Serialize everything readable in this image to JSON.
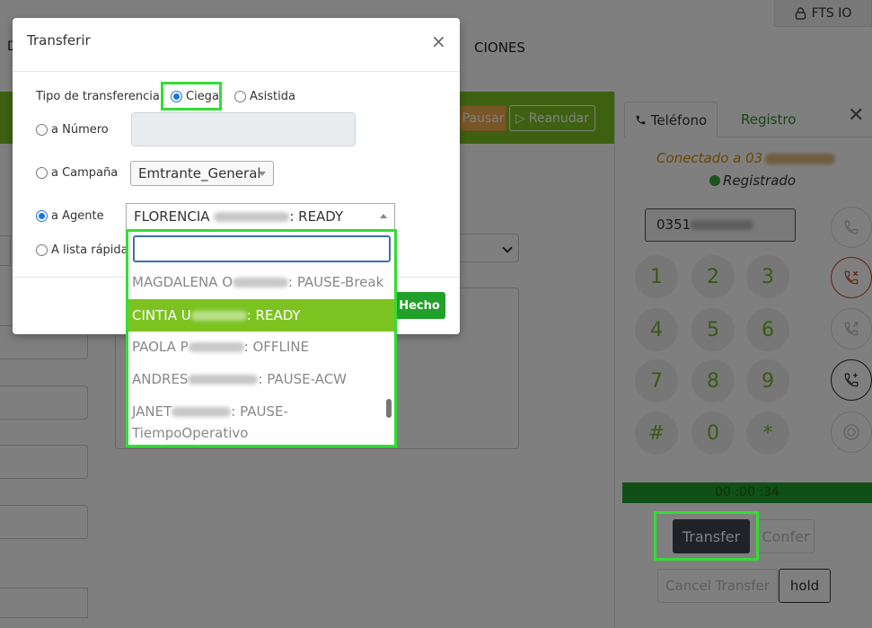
{
  "header": {
    "user_label": "FTS IO",
    "nav_fragment": "CIONES"
  },
  "toolbar": {
    "pause_label": "Pausar",
    "resume_label": "Reanudar"
  },
  "phone": {
    "tab_phone": "Teléfono",
    "tab_log": "Registro",
    "connected_prefix": "Conectado a 03",
    "registered": "Registrado",
    "number_prefix": "0351",
    "keys": [
      "1",
      "2",
      "3",
      "4",
      "5",
      "6",
      "7",
      "8",
      "9",
      "#",
      "0",
      "*"
    ],
    "timer": "00 :00 :34",
    "transfer": "Transfer",
    "confer": "Confer",
    "cancel_transfer": "Cancel Transfer",
    "hold": "hold",
    "colors": {
      "accent": "#7cc322",
      "timer_bar": "#209e2a",
      "highlight": "#33dd33"
    }
  },
  "modal": {
    "title": "Transferir",
    "type_label": "Tipo de transferencia:",
    "type_blind": "Ciega",
    "type_assisted": "Asistida",
    "to_number": "a Número",
    "to_campaign": "a Campaña",
    "campaign_value": "Emtrante_General",
    "to_agent": "a Agente",
    "agent_selected_prefix": "FLORENCIA",
    "agent_selected_suffix": ": READY",
    "to_quicklist": "A lista rápida",
    "done": "Hecho"
  },
  "dropdown": {
    "search_value": "",
    "items": [
      {
        "prefix": "MAGDALENA O",
        "suffix": ": PAUSE-Break"
      },
      {
        "prefix": "CINTIA U",
        "suffix": ": READY"
      },
      {
        "prefix": "PAOLA P",
        "suffix": ": OFFLINE"
      },
      {
        "prefix": "ANDRES",
        "suffix": ": PAUSE-ACW"
      },
      {
        "prefix": "JANET",
        "suffix": ": PAUSE-",
        "line2": "TiempoOperativo"
      }
    ]
  }
}
